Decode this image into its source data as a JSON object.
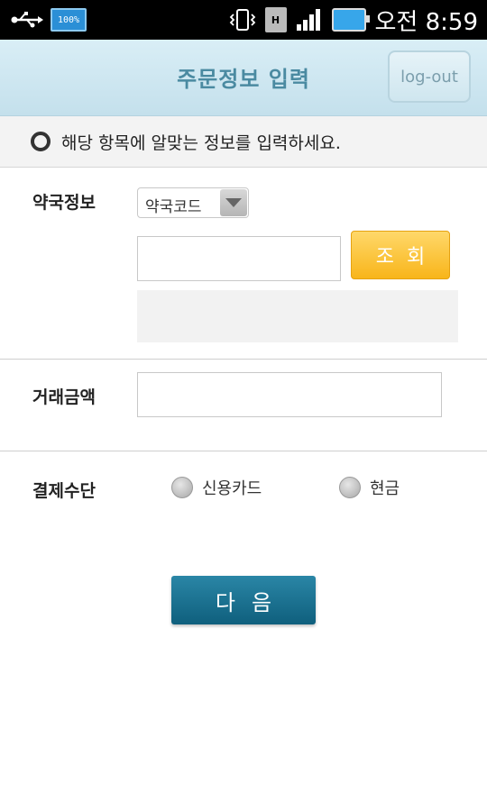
{
  "status_bar": {
    "battery_badge": "100%",
    "hspa_label": "H",
    "time": "오전 8:59"
  },
  "header": {
    "title": "주문정보 입력",
    "logout_label": "log-out"
  },
  "instruction": {
    "text": "해당 항목에 알맞는 정보를 입력하세요."
  },
  "form": {
    "pharmacy_label": "약국정보",
    "pharmacy_select_value": "약국코드",
    "search_button_label": "조회",
    "amount_label": "거래금액",
    "payment_label": "결제수단",
    "payment_options": [
      "신용카드",
      "현금"
    ],
    "next_button_label": "다음"
  },
  "colors": {
    "header_bg": "#cfe7f1",
    "search_button": "#f8b51a",
    "next_button": "#15678a"
  }
}
